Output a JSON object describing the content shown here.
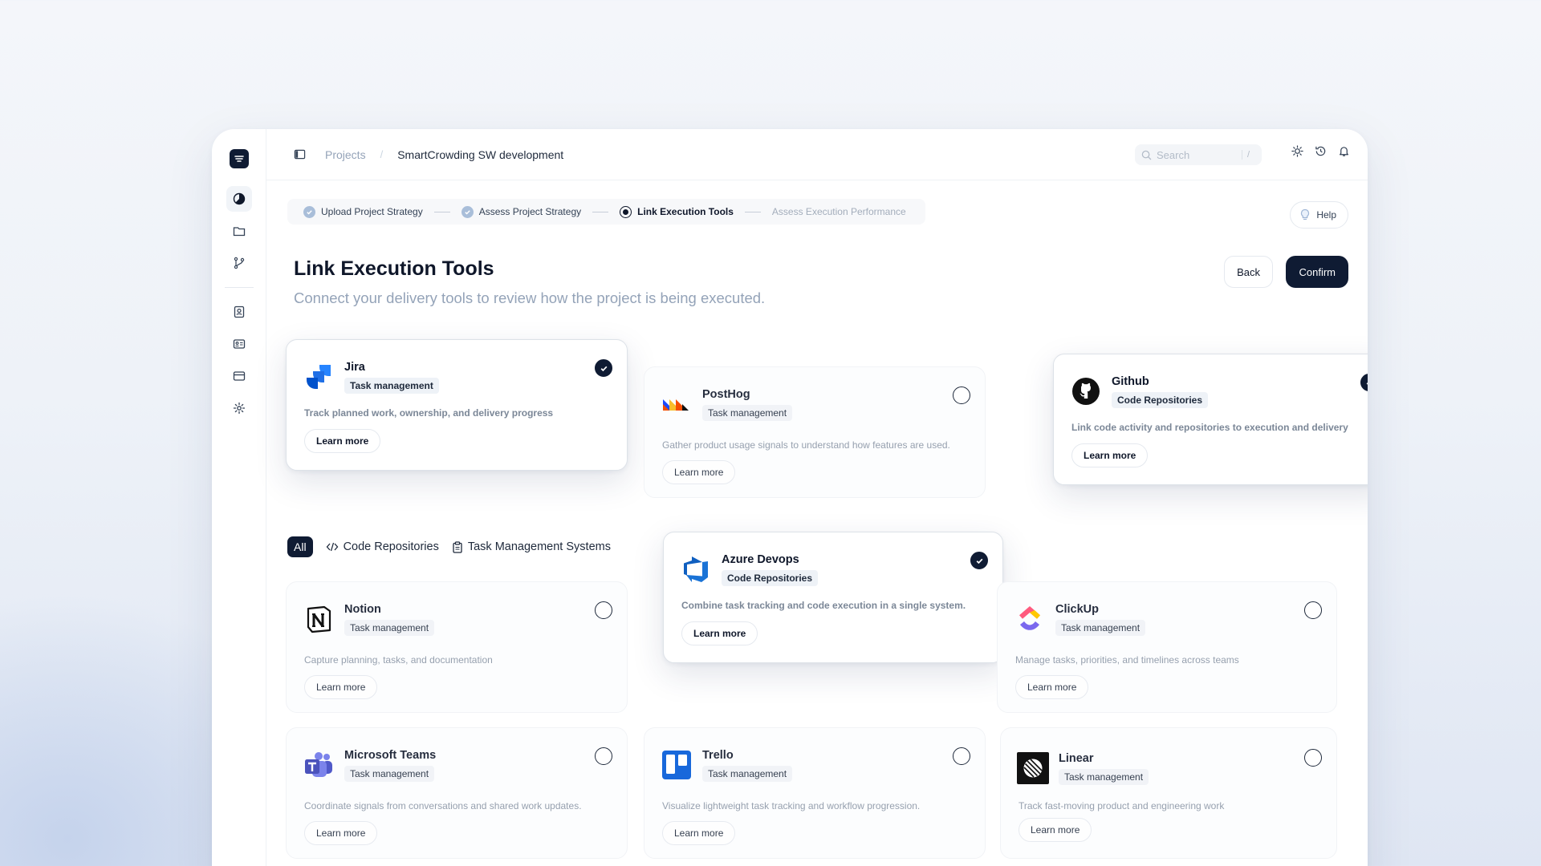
{
  "breadcrumb": {
    "root": "Projects",
    "separator": "/",
    "current": "SmartCrowding SW development"
  },
  "search": {
    "placeholder": "Search",
    "shortcut": "/"
  },
  "steps": [
    {
      "label": "Upload Project Strategy",
      "state": "done"
    },
    {
      "label": "Assess Project Strategy",
      "state": "done"
    },
    {
      "label": "Link Execution Tools",
      "state": "current"
    },
    {
      "label": "Assess Execution Performance",
      "state": "pending"
    }
  ],
  "help_label": "Help",
  "page": {
    "title": "Link Execution Tools",
    "subtitle": "Connect your delivery tools to review how the project is being executed."
  },
  "actions": {
    "back": "Back",
    "confirm": "Confirm"
  },
  "filters": {
    "all": "All",
    "code": "Code Repositories",
    "task": "Task Management Systems"
  },
  "learn_more": "Learn more",
  "tools": {
    "jira": {
      "name": "Jira",
      "category": "Task management",
      "description": "Track planned work, ownership, and delivery progress",
      "selected": true
    },
    "posthog": {
      "name": "PostHog",
      "category": "Task management",
      "description": "Gather product usage signals to understand how features are used.",
      "selected": false
    },
    "github": {
      "name": "Github",
      "category": "Code Repositories",
      "description": "Link code activity and repositories to execution and delivery",
      "selected": true
    },
    "azure": {
      "name": "Azure Devops",
      "category": "Code Repositories",
      "description": "Combine task tracking and code execution in a single system.",
      "selected": true
    },
    "notion": {
      "name": "Notion",
      "category": "Task management",
      "description": "Capture planning, tasks, and documentation",
      "selected": false
    },
    "clickup": {
      "name": "ClickUp",
      "category": "Task management",
      "description": "Manage tasks, priorities, and timelines across teams",
      "selected": false
    },
    "teams": {
      "name": "Microsoft Teams",
      "category": "Task management",
      "description": "Coordinate signals from conversations and shared work updates.",
      "selected": false
    },
    "trello": {
      "name": "Trello",
      "category": "Task management",
      "description": "Visualize lightweight task tracking and workflow progression.",
      "selected": false
    },
    "linear": {
      "name": "Linear",
      "category": "Task management",
      "description": "Track fast-moving product and engineering work",
      "selected": false
    }
  },
  "colors": {
    "primary": "#0f1b33",
    "muted": "#94a3b8",
    "step_done": "#a9bed9"
  }
}
